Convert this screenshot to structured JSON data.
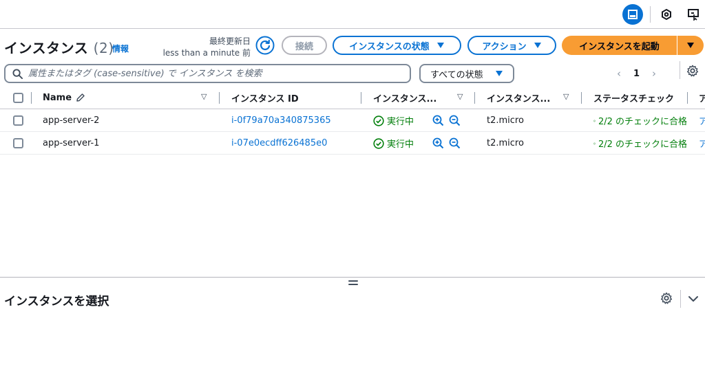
{
  "header": {
    "title": "インスタンス",
    "count": "(2)",
    "info": "情報",
    "updated_label": "最終更新日",
    "updated_value": "less than a minute 前",
    "connect": "接続",
    "instance_state": "インスタンスの状態",
    "actions": "アクション",
    "launch": "インスタンスを起動"
  },
  "filter": {
    "search_placeholder": "属性またはタグ (case-sensitive) で インスタンス を検索",
    "state_select": "すべての状態",
    "page": "1"
  },
  "table": {
    "columns": [
      "Name",
      "インスタンス ID",
      "インスタンス...",
      "インスタンス...",
      "ステータスチェック",
      "ア"
    ],
    "rows": [
      {
        "name": "app-server-2",
        "id": "i-0f79a70a340875365",
        "state": "実行中",
        "type": "t2.micro",
        "check": "2/2 のチェックに合格",
        "extra": "ア"
      },
      {
        "name": "app-server-1",
        "id": "i-07e0ecdff626485e0",
        "state": "実行中",
        "type": "t2.micro",
        "check": "2/2 のチェックに合格",
        "extra": "ア"
      }
    ]
  },
  "split_panel": {
    "title": "インスタンスを選択"
  },
  "colors": {
    "primary": "#0972d3",
    "launch": "#f89c33",
    "success": "#037f0c"
  }
}
